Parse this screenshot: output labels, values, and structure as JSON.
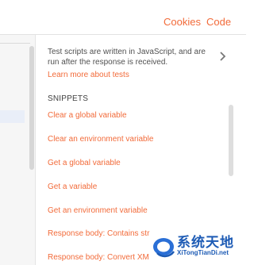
{
  "header": {
    "links": [
      "Cookies",
      "Code"
    ]
  },
  "tests_panel": {
    "description": "Test scripts are written in JavaScript, and are run after the response is received.",
    "learn_more": "Learn more about tests",
    "snippets_heading": "SNIPPETS",
    "snippets": [
      "Clear a global variable",
      "Clear an environment variable",
      "Get a global variable",
      "Get a variable",
      "Get an environment variable",
      "Response body: Contains str",
      "Response body: Convert XM"
    ]
  },
  "watermark": {
    "title": "系统天地",
    "url": "XiTongTianDi.net"
  },
  "colors": {
    "accent": "#f26b3a",
    "watermark": "#1d5bb5"
  },
  "icons": {
    "expand": "chevron-right-icon",
    "watermark_logo": "watermark-logo-icon"
  }
}
